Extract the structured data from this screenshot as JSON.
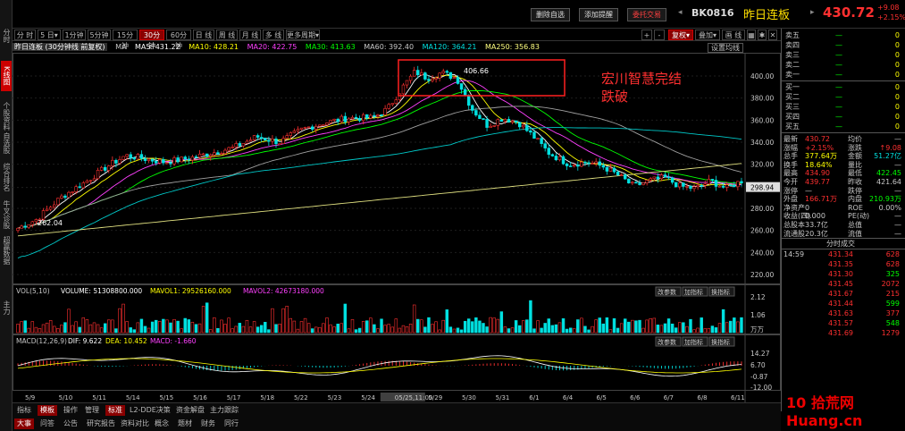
{
  "left_tabs": [
    "分时",
    "K线图",
    "个股资料",
    "自选股",
    "综合排名",
    "牛叉诊股",
    "超赢数据",
    "主力"
  ],
  "header": {
    "buttons": [
      "删除自选",
      "添加提醒",
      "委托交易"
    ],
    "code": "BK0816",
    "name": "昨日连板",
    "price": "430.72",
    "change": "+9.08",
    "change_pct": "+2.15%"
  },
  "period_buttons": [
    "分 时",
    "5 日▾",
    "1分钟",
    "5分钟",
    "15分钟",
    "30分钟",
    "60分钟",
    "日 线",
    "周 线",
    "月 线",
    "多 线",
    "更多周期▾"
  ],
  "active_period": "30分钟",
  "toolbar_right": [
    "+",
    "-",
    "复权▾",
    "叠加▾",
    "画 线",
    "",
    "",
    ""
  ],
  "ma_line": {
    "title": "昨日连板 (30分钟线 前复权)",
    "items": [
      {
        "label": "MA",
        "color": "#c8c8c8"
      },
      {
        "label": "MA5: 431.22",
        "color": "#ffffff"
      },
      {
        "label": "MA10: 428.21",
        "color": "#ffff00"
      },
      {
        "label": "MA20: 422.75",
        "color": "#ff40ff"
      },
      {
        "label": "MA30: 413.63",
        "color": "#00ff00"
      },
      {
        "label": "MA60: 392.40",
        "color": "#c8c8c8"
      },
      {
        "label": "MA120: 364.21",
        "color": "#00e0e0"
      },
      {
        "label": "MA250: 356.83",
        "color": "#ffff80"
      }
    ],
    "settings": "设置均线"
  },
  "price_axis": [
    "400.00",
    "380.00",
    "360.00",
    "340.00",
    "320.00",
    "298.94",
    "280.00",
    "260.00",
    "240.00",
    "220.00"
  ],
  "price_labels": {
    "high": "406.66",
    "low": "262.04"
  },
  "annotation": {
    "line1": "宏川智慧完结",
    "line2": "跌破"
  },
  "volume": {
    "legend": "VOL(5,10)",
    "volume": "VOLUME: 51308800.000",
    "mavol1": "MAVOL1: 29526160.000",
    "mavol2": "MAVOL2: 42673180.000",
    "axis": [
      "2.12",
      "1.06"
    ],
    "unit": "万万",
    "buttons": [
      "改参数",
      "加指标",
      "换指标"
    ]
  },
  "macd": {
    "legend": "MACD(12,26,9)",
    "dif": "DIF: 9.622",
    "dea": "DEA: 10.452",
    "macd": "MACD: -1.660",
    "axis": [
      "14.27",
      "6.70",
      "-0.87",
      "-12.00"
    ],
    "buttons": [
      "改参数",
      "加指标",
      "换指标"
    ]
  },
  "date_axis": [
    "5/9",
    "5/10",
    "5/11",
    "5/14",
    "5/15",
    "5/16",
    "5/17",
    "5/18",
    "5/22",
    "5/23",
    "5/24",
    "05/25,11:00",
    "5/29",
    "5/30",
    "5/31",
    "6/1",
    "6/4",
    "6/5",
    "6/6",
    "6/7",
    "6/8",
    "6/11"
  ],
  "order_book": {
    "sell": [
      {
        "label": "卖五",
        "price": "—",
        "vol": "0"
      },
      {
        "label": "卖四",
        "price": "—",
        "vol": "0"
      },
      {
        "label": "卖三",
        "price": "—",
        "vol": "0"
      },
      {
        "label": "卖二",
        "price": "—",
        "vol": "0"
      },
      {
        "label": "卖一",
        "price": "—",
        "vol": "0"
      }
    ],
    "buy": [
      {
        "label": "买一",
        "price": "—",
        "vol": "0"
      },
      {
        "label": "买二",
        "price": "—",
        "vol": "0"
      },
      {
        "label": "买三",
        "price": "—",
        "vol": "0"
      },
      {
        "label": "买四",
        "price": "—",
        "vol": "0"
      },
      {
        "label": "买五",
        "price": "—",
        "vol": "0"
      }
    ]
  },
  "stats": [
    {
      "l1": "最新",
      "v1": "430.72",
      "c1": "#ff3030",
      "l2": "均价",
      "v2": "—",
      "c2": "#c8c8c8"
    },
    {
      "l1": "涨幅",
      "v1": "+2.15%",
      "c1": "#ff3030",
      "l2": "涨跌",
      "v2": "↑9.08",
      "c2": "#ff3030"
    },
    {
      "l1": "总手",
      "v1": "377.64万",
      "c1": "#ffff00",
      "l2": "金额",
      "v2": "51.27亿",
      "c2": "#00e0e0"
    },
    {
      "l1": "换手",
      "v1": "18.64%",
      "c1": "#ffff00",
      "l2": "量比",
      "v2": "—",
      "c2": "#c8c8c8"
    },
    {
      "l1": "最高",
      "v1": "434.90",
      "c1": "#ff3030",
      "l2": "最低",
      "v2": "422.45",
      "c2": "#00ff00"
    },
    {
      "l1": "今开",
      "v1": "439.77",
      "c1": "#ff3030",
      "l2": "昨收",
      "v2": "421.64",
      "c2": "#c8c8c8"
    },
    {
      "l1": "涨停",
      "v1": "—",
      "c1": "#c8c8c8",
      "l2": "跌停",
      "v2": "—",
      "c2": "#c8c8c8"
    },
    {
      "l1": "外盘",
      "v1": "166.71万",
      "c1": "#ff3030",
      "l2": "内盘",
      "v2": "210.93万",
      "c2": "#00ff00"
    },
    {
      "l1": "净资产",
      "v1": "0",
      "c1": "#c8c8c8",
      "l2": "ROE",
      "v2": "0.00%",
      "c2": "#c8c8c8"
    },
    {
      "l1": "收益(四)",
      "v1": "0.000",
      "c1": "#c8c8c8",
      "l2": "PE(动)",
      "v2": "—",
      "c2": "#c8c8c8"
    },
    {
      "l1": "总股本",
      "v1": "33.7亿",
      "c1": "#c8c8c8",
      "l2": "总值",
      "v2": "—",
      "c2": "#c8c8c8"
    },
    {
      "l1": "流通股",
      "v1": "20.3亿",
      "c1": "#c8c8c8",
      "l2": "流值",
      "v2": "—",
      "c2": "#c8c8c8"
    }
  ],
  "tick_header": "分时成交",
  "ticks": [
    {
      "time": "14:59",
      "price": "431.34",
      "vol": "628",
      "vc": "#ff3030"
    },
    {
      "time": "",
      "price": "431.35",
      "vol": "628",
      "vc": "#ff3030"
    },
    {
      "time": "",
      "price": "431.30",
      "vol": "325",
      "vc": "#00ff00"
    },
    {
      "time": "",
      "price": "431.45",
      "vol": "2072",
      "vc": "#ff3030"
    },
    {
      "time": "",
      "price": "431.67",
      "vol": "215",
      "vc": "#ff3030"
    },
    {
      "time": "",
      "price": "431.44",
      "vol": "599",
      "vc": "#00ff00"
    },
    {
      "time": "",
      "price": "431.63",
      "vol": "377",
      "vc": "#ff3030"
    },
    {
      "time": "",
      "price": "431.57",
      "vol": "548",
      "vc": "#00ff00"
    },
    {
      "time": "",
      "price": "431.69",
      "vol": "1279",
      "vc": "#ff3030"
    }
  ],
  "bottom_tabs_row1": [
    "指标",
    "模板",
    "操作",
    "管理",
    "标准",
    "L2-DDE决策",
    "资金解盘",
    "主力跟踪"
  ],
  "bottom_tabs_row2": [
    "大事",
    "问答",
    "公告",
    "研究报告",
    "资料对比",
    "概念",
    "题材",
    "财务",
    "同行"
  ],
  "watermark": "10 拾荒网 Huang.cn"
}
